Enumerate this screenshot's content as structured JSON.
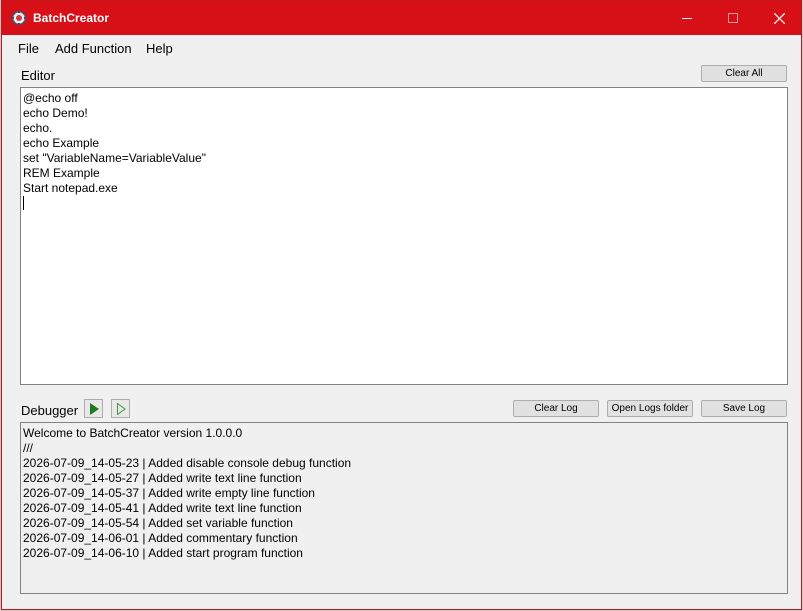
{
  "window": {
    "title": "BatchCreator",
    "accent_color": "#d70f17"
  },
  "menu": {
    "items": [
      {
        "label": "File"
      },
      {
        "label": "Add Function"
      },
      {
        "label": "Help"
      }
    ]
  },
  "editor": {
    "label": "Editor",
    "clear_all_label": "Clear All",
    "content": "@echo off\necho Demo!\necho.\necho Example\nset \"VariableName=VariableValue\"\nREM Example\nStart notepad.exe"
  },
  "debugger": {
    "label": "Debugger",
    "run_icon": "play-icon",
    "step_icon": "step-play-icon",
    "clear_log_label": "Clear Log",
    "open_logs_label": "Open Logs folder",
    "save_log_label": "Save Log",
    "lines": [
      "Welcome to BatchCreator version 1.0.0.0",
      "///",
      "2026-07-09_14-05-23 | Added disable console debug function",
      "2026-07-09_14-05-27 | Added write text line function",
      "2026-07-09_14-05-37 | Added write empty line function",
      "2026-07-09_14-05-41 | Added write text line function",
      "2026-07-09_14-05-54 | Added set variable function",
      "2026-07-09_14-06-01 | Added commentary function",
      "2026-07-09_14-06-10 | Added start program function"
    ]
  }
}
